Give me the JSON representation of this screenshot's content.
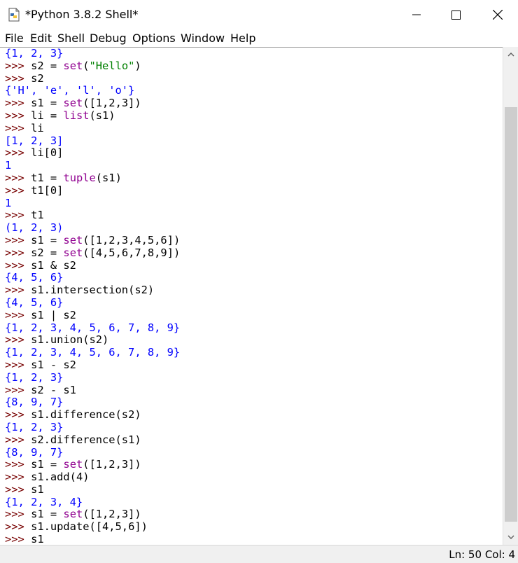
{
  "window": {
    "title": "*Python 3.8.2 Shell*"
  },
  "menu": [
    "File",
    "Edit",
    "Shell",
    "Debug",
    "Options",
    "Window",
    "Help"
  ],
  "shell": {
    "lines": [
      [
        {
          "t": "{1, 2, 3}",
          "c": "out"
        }
      ],
      [
        {
          "t": ">>> ",
          "c": "prompt"
        },
        {
          "t": "s2 = ",
          "c": "plain"
        },
        {
          "t": "set",
          "c": "bi"
        },
        {
          "t": "(",
          "c": "plain"
        },
        {
          "t": "\"Hello\"",
          "c": "str"
        },
        {
          "t": ")",
          "c": "plain"
        }
      ],
      [
        {
          "t": ">>> ",
          "c": "prompt"
        },
        {
          "t": "s2",
          "c": "plain"
        }
      ],
      [
        {
          "t": "{'H', 'e', 'l', 'o'}",
          "c": "out"
        }
      ],
      [
        {
          "t": ">>> ",
          "c": "prompt"
        },
        {
          "t": "s1 = ",
          "c": "plain"
        },
        {
          "t": "set",
          "c": "bi"
        },
        {
          "t": "([1,2,3])",
          "c": "plain"
        }
      ],
      [
        {
          "t": ">>> ",
          "c": "prompt"
        },
        {
          "t": "li = ",
          "c": "plain"
        },
        {
          "t": "list",
          "c": "bi"
        },
        {
          "t": "(s1)",
          "c": "plain"
        }
      ],
      [
        {
          "t": ">>> ",
          "c": "prompt"
        },
        {
          "t": "li",
          "c": "plain"
        }
      ],
      [
        {
          "t": "[1, 2, 3]",
          "c": "out"
        }
      ],
      [
        {
          "t": ">>> ",
          "c": "prompt"
        },
        {
          "t": "li[0]",
          "c": "plain"
        }
      ],
      [
        {
          "t": "1",
          "c": "out"
        }
      ],
      [
        {
          "t": ">>> ",
          "c": "prompt"
        },
        {
          "t": "t1 = ",
          "c": "plain"
        },
        {
          "t": "tuple",
          "c": "bi"
        },
        {
          "t": "(s1)",
          "c": "plain"
        }
      ],
      [
        {
          "t": ">>> ",
          "c": "prompt"
        },
        {
          "t": "t1[0]",
          "c": "plain"
        }
      ],
      [
        {
          "t": "1",
          "c": "out"
        }
      ],
      [
        {
          "t": ">>> ",
          "c": "prompt"
        },
        {
          "t": "t1",
          "c": "plain"
        }
      ],
      [
        {
          "t": "(1, 2, 3)",
          "c": "out"
        }
      ],
      [
        {
          "t": ">>> ",
          "c": "prompt"
        },
        {
          "t": "s1 = ",
          "c": "plain"
        },
        {
          "t": "set",
          "c": "bi"
        },
        {
          "t": "([1,2,3,4,5,6])",
          "c": "plain"
        }
      ],
      [
        {
          "t": ">>> ",
          "c": "prompt"
        },
        {
          "t": "s2 = ",
          "c": "plain"
        },
        {
          "t": "set",
          "c": "bi"
        },
        {
          "t": "([4,5,6,7,8,9])",
          "c": "plain"
        }
      ],
      [
        {
          "t": ">>> ",
          "c": "prompt"
        },
        {
          "t": "s1 & s2",
          "c": "plain"
        }
      ],
      [
        {
          "t": "{4, 5, 6}",
          "c": "out"
        }
      ],
      [
        {
          "t": ">>> ",
          "c": "prompt"
        },
        {
          "t": "s1.intersection(s2)",
          "c": "plain"
        }
      ],
      [
        {
          "t": "{4, 5, 6}",
          "c": "out"
        }
      ],
      [
        {
          "t": ">>> ",
          "c": "prompt"
        },
        {
          "t": "s1 | s2",
          "c": "plain"
        }
      ],
      [
        {
          "t": "{1, 2, 3, 4, 5, 6, 7, 8, 9}",
          "c": "out"
        }
      ],
      [
        {
          "t": ">>> ",
          "c": "prompt"
        },
        {
          "t": "s1.union(s2)",
          "c": "plain"
        }
      ],
      [
        {
          "t": "{1, 2, 3, 4, 5, 6, 7, 8, 9}",
          "c": "out"
        }
      ],
      [
        {
          "t": ">>> ",
          "c": "prompt"
        },
        {
          "t": "s1 - s2",
          "c": "plain"
        }
      ],
      [
        {
          "t": "{1, 2, 3}",
          "c": "out"
        }
      ],
      [
        {
          "t": ">>> ",
          "c": "prompt"
        },
        {
          "t": "s2 - s1",
          "c": "plain"
        }
      ],
      [
        {
          "t": "{8, 9, 7}",
          "c": "out"
        }
      ],
      [
        {
          "t": ">>> ",
          "c": "prompt"
        },
        {
          "t": "s1.difference(s2)",
          "c": "plain"
        }
      ],
      [
        {
          "t": "{1, 2, 3}",
          "c": "out"
        }
      ],
      [
        {
          "t": ">>> ",
          "c": "prompt"
        },
        {
          "t": "s2.difference(s1)",
          "c": "plain"
        }
      ],
      [
        {
          "t": "{8, 9, 7}",
          "c": "out"
        }
      ],
      [
        {
          "t": ">>> ",
          "c": "prompt"
        },
        {
          "t": "s1 = ",
          "c": "plain"
        },
        {
          "t": "set",
          "c": "bi"
        },
        {
          "t": "([1,2,3])",
          "c": "plain"
        }
      ],
      [
        {
          "t": ">>> ",
          "c": "prompt"
        },
        {
          "t": "s1.add(4)",
          "c": "plain"
        }
      ],
      [
        {
          "t": ">>> ",
          "c": "prompt"
        },
        {
          "t": "s1",
          "c": "plain"
        }
      ],
      [
        {
          "t": "{1, 2, 3, 4}",
          "c": "out"
        }
      ],
      [
        {
          "t": ">>> ",
          "c": "prompt"
        },
        {
          "t": "s1 = ",
          "c": "plain"
        },
        {
          "t": "set",
          "c": "bi"
        },
        {
          "t": "([1,2,3])",
          "c": "plain"
        }
      ],
      [
        {
          "t": ">>> ",
          "c": "prompt"
        },
        {
          "t": "s1.update([4,5,6])",
          "c": "plain"
        }
      ],
      [
        {
          "t": ">>> ",
          "c": "prompt"
        },
        {
          "t": "s1",
          "c": "plain"
        }
      ]
    ]
  },
  "status": {
    "line": "Ln: 50",
    "col": "Col: 4"
  }
}
